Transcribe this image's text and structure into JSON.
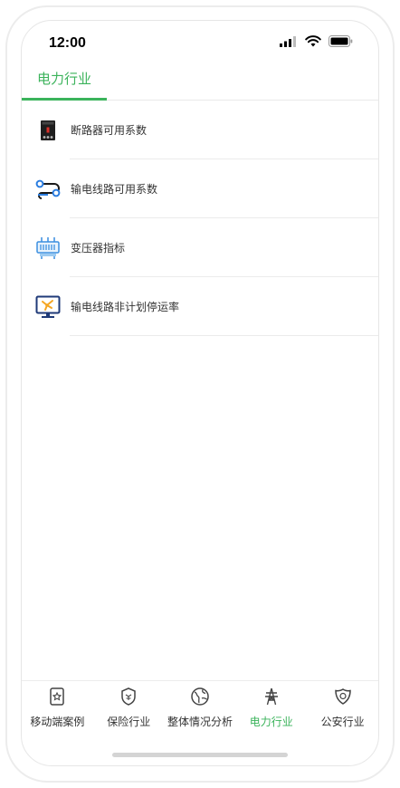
{
  "status_bar": {
    "time": "12:00"
  },
  "tab_header": {
    "active_tab": "电力行业"
  },
  "menu": {
    "items": [
      {
        "label": "断路器可用系数",
        "icon": "circuit-breaker-icon"
      },
      {
        "label": "输电线路可用系数",
        "icon": "transmission-line-icon"
      },
      {
        "label": "变压器指标",
        "icon": "transformer-icon"
      },
      {
        "label": "输电线路非计划停运率",
        "icon": "outage-monitor-icon"
      }
    ]
  },
  "bottom_nav": {
    "items": [
      {
        "label": "移动端案例",
        "icon": "mobile-case-icon"
      },
      {
        "label": "保险行业",
        "icon": "insurance-shield-icon"
      },
      {
        "label": "整体情况分析",
        "icon": "globe-icon"
      },
      {
        "label": "电力行业",
        "icon": "power-tower-icon",
        "active": true
      },
      {
        "label": "公安行业",
        "icon": "police-badge-icon"
      }
    ]
  },
  "colors": {
    "accent": "#3bb35b",
    "text": "#333333"
  }
}
